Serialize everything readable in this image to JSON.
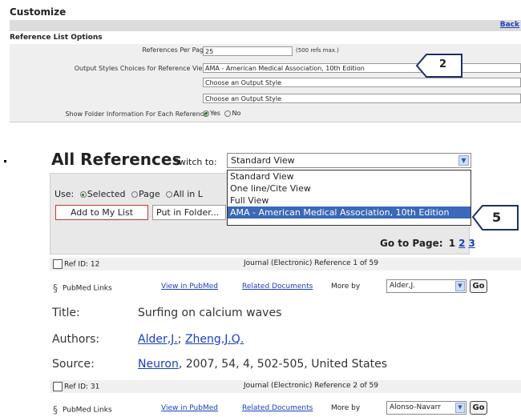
{
  "header": {
    "title": "Customize",
    "back_link": "Back"
  },
  "settings": {
    "section_title": "Reference List Options",
    "refs_per_page": {
      "label": "References Per Page",
      "value": "25",
      "hint": "(500 refs max.)"
    },
    "output_styles": {
      "label": "Output Styles Choices for Reference View",
      "choices": [
        "AMA - American Medical Association, 10th Edition",
        "Choose an Output Style",
        "Choose an Output Style"
      ]
    },
    "folder_info": {
      "label": "Show Folder Information For Each Reference",
      "yes": "Yes",
      "no": "No",
      "selected": "Yes"
    }
  },
  "callouts": {
    "top": "2",
    "bottom": "5"
  },
  "references": {
    "title": "All References",
    "switch_to_label": "Switch to:",
    "view_selected": "Standard View",
    "view_options": [
      "Standard View",
      "One line/Cite View",
      "Full View",
      "AMA - American Medical Association, 10th Edition"
    ],
    "highlighted_option": "AMA - American Medical Association, 10th Edition",
    "use_label": "Use:",
    "use_options": [
      "Selected",
      "Page",
      "All in L"
    ],
    "add_button": "Add to My List",
    "folder_button": "Put in Folder...",
    "goto_label": "Go to Page:",
    "pages": [
      "1",
      "2",
      "3"
    ]
  },
  "items": [
    {
      "ref_id": "Ref ID: 12",
      "type_label": "Journal (Electronic) Reference 1 of 59",
      "pubmed_label": "PubMed Links",
      "view_pubmed": "View in PubMed",
      "related": "Related Documents",
      "more_by": "More by",
      "author_select": "Alder,J.",
      "go": "Go",
      "title_label": "Title:",
      "title": "Surfing on calcium waves",
      "authors_label": "Authors:",
      "authors": [
        "Alder,J.",
        "Zheng,J.Q."
      ],
      "source_label": "Source:",
      "source_journal": "Neuron",
      "source_rest": ", 2007, 54, 4, 502-505, United States"
    },
    {
      "ref_id": "Ref ID: 31",
      "type_label": "Journal (Electronic) Reference 2 of 59",
      "pubmed_label": "PubMed Links",
      "view_pubmed": "View in PubMed",
      "related": "Related Documents",
      "more_by": "More by",
      "author_select": "Alonso-Navarr",
      "go": "Go"
    }
  ]
}
